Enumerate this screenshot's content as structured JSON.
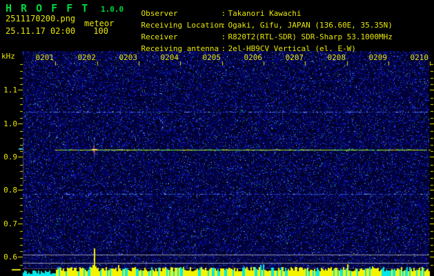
{
  "header": {
    "app_title": "H R O F F T",
    "version": "1.0.0",
    "filename": "2511170200.png",
    "mode": "meteor",
    "timestamp": "25.11.17 02:00",
    "count": "100",
    "info_rows": [
      {
        "label": "Observer",
        "sep": ":",
        "value": "Takanori Kawachi"
      },
      {
        "label": "Receiving Location",
        "sep": ":",
        "value": "Ogaki, Gifu, JAPAN (136.60E, 35.35N)"
      },
      {
        "label": "Receiver",
        "sep": ":",
        "value": "R820T2(RTL-SDR) SDR-Sharp 53.1000MHz"
      },
      {
        "label": "Receiving antenna",
        "sep": ":",
        "value": "2el-HB9CV Vertical (el. E-W)"
      }
    ]
  },
  "colors": {
    "title_green": "#00d83c",
    "text_yellow": "#e8e808",
    "noise_blue": "#2233cc",
    "carrier_green": "#7aff2d",
    "carrier_yellow": "#f0e800",
    "echo_red": "#ff4060",
    "level_cyan": "#00e8e8",
    "level_yellow": "#f4f400",
    "ref_line_gray": "#b9b9c8",
    "background": "#000000"
  },
  "chart_data": {
    "type": "heatmap",
    "title": "HROFFT 10-minute radio meteor spectrogram with signal-level strip",
    "x_axis": {
      "unit": "time (hhmm)",
      "start": "0200",
      "end": "0210",
      "tick_labels": [
        "0201",
        "0202",
        "0203",
        "0204",
        "0205",
        "0206",
        "0207",
        "0208",
        "0209",
        "0210"
      ],
      "minutes_span": 10
    },
    "y_axis": {
      "unit": "kHz",
      "tick_labels": [
        "1.1",
        "1.0",
        "0.9",
        "0.8",
        "0.7",
        "0.6"
      ],
      "range_khz": [
        0.56,
        1.18
      ],
      "minor_step_khz": 0.02
    },
    "carrier": {
      "khz": 0.92,
      "start_hhmm": "0201",
      "end_hhmm": "0210",
      "appearance": "yellow-green continuous line"
    },
    "meteor_echo": {
      "hhmm": "0201:55",
      "khz_center": 0.92,
      "khz_spread": [
        0.885,
        0.955
      ],
      "core_color": "red"
    },
    "faint_lines_khz": [
      1.035,
      0.788
    ],
    "level_ref_lines_khz": [
      0.607,
      0.582
    ],
    "level_strip": {
      "quiet_until_hhmm": "0201",
      "quiet_color": "cyan",
      "active_color": "yellow mixed with cyan",
      "spike_hhmm": "0201:55"
    },
    "noise_floor": "dark blue speckle"
  }
}
